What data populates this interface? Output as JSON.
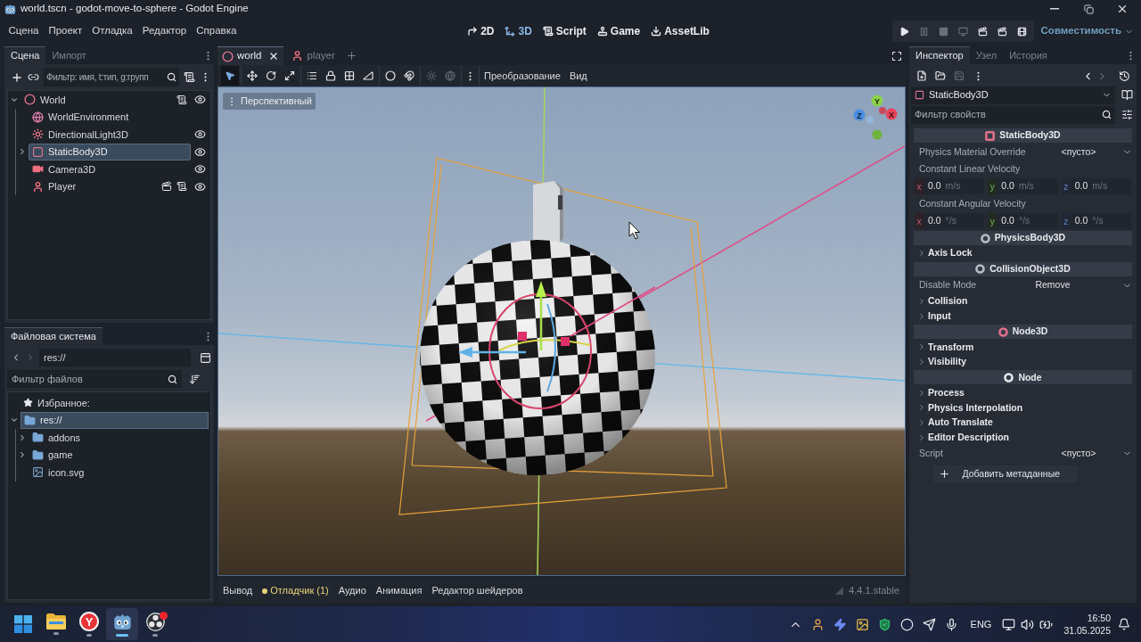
{
  "window": {
    "title": "world.tscn - godot-move-to-sphere - Godot Engine"
  },
  "menu": [
    "Сцена",
    "Проект",
    "Отладка",
    "Редактор",
    "Справка"
  ],
  "workspaces": [
    {
      "label": "2D",
      "kind": "canvas",
      "selected": false
    },
    {
      "label": "3D",
      "kind": "spatial",
      "selected": true
    },
    {
      "label": "Script",
      "kind": "script",
      "selected": false
    },
    {
      "label": "Game",
      "kind": "game",
      "selected": false
    },
    {
      "label": "AssetLib",
      "kind": "assetlib",
      "selected": false
    }
  ],
  "run_controls": [
    {
      "kind": "play",
      "disabled": false
    },
    {
      "kind": "pause",
      "disabled": true
    },
    {
      "kind": "stop",
      "disabled": true
    },
    {
      "kind": "remote",
      "disabled": true
    },
    {
      "kind": "scene",
      "disabled": false
    },
    {
      "kind": "custom",
      "disabled": false
    },
    {
      "kind": "movie",
      "disabled": false
    }
  ],
  "renderer": "Совместимость",
  "scene_dock": {
    "tabs": [
      {
        "label": "Сцена",
        "selected": true
      },
      {
        "label": "Импорт",
        "selected": false
      }
    ],
    "filter": {
      "placeholder": "Фильтр: имя, t:тип, g:групп"
    },
    "tree": [
      {
        "name": "World",
        "kind": "node3d",
        "expandable": true,
        "expanded": true,
        "selected": false,
        "instance": false,
        "script": true,
        "eye": true,
        "children": [
          {
            "name": "WorldEnvironment",
            "kind": "environment",
            "expandable": false,
            "expanded": false,
            "selected": false,
            "instance": false,
            "script": false,
            "eye": false
          },
          {
            "name": "DirectionalLight3D",
            "kind": "light",
            "expandable": false,
            "expanded": false,
            "selected": false,
            "instance": false,
            "script": false,
            "eye": true
          },
          {
            "name": "StaticBody3D",
            "kind": "body",
            "expandable": true,
            "expanded": false,
            "selected": true,
            "instance": false,
            "script": false,
            "eye": true
          },
          {
            "name": "Camera3D",
            "kind": "camera",
            "expandable": false,
            "expanded": false,
            "selected": false,
            "instance": false,
            "script": false,
            "eye": true
          },
          {
            "name": "Player",
            "kind": "character",
            "expandable": false,
            "expanded": false,
            "selected": false,
            "instance": true,
            "script": true,
            "eye": true
          }
        ]
      }
    ]
  },
  "filesystem": {
    "tabs": [
      {
        "label": "Файловая система",
        "selected": true
      }
    ],
    "path": "res://",
    "filter": {
      "placeholder": "Фильтр файлов"
    },
    "favorites": "Избранное:",
    "tree": [
      {
        "name": "res://",
        "kind": "folder",
        "expandable": true,
        "expanded": true,
        "selected": true,
        "children": [
          {
            "name": "addons",
            "kind": "folder",
            "expandable": true,
            "expanded": false,
            "selected": false
          },
          {
            "name": "game",
            "kind": "folder",
            "expandable": true,
            "expanded": false,
            "selected": false
          },
          {
            "name": "icon.svg",
            "kind": "image",
            "expandable": false,
            "expanded": false,
            "selected": false
          }
        ]
      }
    ]
  },
  "editor_tabs": [
    {
      "label": "world",
      "kind": "node3d",
      "selected": true
    },
    {
      "label": "player",
      "kind": "character",
      "selected": false
    }
  ],
  "viewport_toolbar": {
    "tool_groups": [
      [
        {
          "kind": "select",
          "selected": true,
          "disabled": false
        }
      ],
      [
        {
          "kind": "move",
          "selected": false,
          "disabled": false
        },
        {
          "kind": "rotate",
          "selected": false,
          "disabled": false
        },
        {
          "kind": "scale",
          "selected": false,
          "disabled": false
        }
      ],
      [
        {
          "kind": "list",
          "selected": false,
          "disabled": false
        },
        {
          "kind": "lock",
          "selected": false,
          "disabled": false
        },
        {
          "kind": "group",
          "selected": false,
          "disabled": false
        },
        {
          "kind": "ruler",
          "selected": false,
          "disabled": false
        }
      ],
      [
        {
          "kind": "preview",
          "selected": false,
          "disabled": false
        },
        {
          "kind": "snap",
          "selected": false,
          "disabled": false
        }
      ],
      [
        {
          "kind": "sun",
          "selected": false,
          "disabled": true
        },
        {
          "kind": "globe",
          "selected": false,
          "disabled": true
        }
      ]
    ],
    "menus": [
      "Преобразование",
      "Вид"
    ]
  },
  "viewport": {
    "view_menu": "Перспективный",
    "gizmo_axes": [
      "Y",
      "Z",
      "X"
    ]
  },
  "bottom_panel": {
    "tabs": [
      {
        "label": "Вывод",
        "alert": false
      },
      {
        "label": "Отладчик (1)",
        "alert": true
      },
      {
        "label": "Аудио",
        "alert": false
      },
      {
        "label": "Анимация",
        "alert": false
      },
      {
        "label": "Редактор шейдеров",
        "alert": false
      }
    ],
    "version": "4.4.1.stable"
  },
  "inspector": {
    "tabs": [
      {
        "label": "Инспектор",
        "selected": true
      },
      {
        "label": "Узел",
        "selected": false
      },
      {
        "label": "История",
        "selected": false
      }
    ],
    "toolbar": [
      {
        "kind": "new",
        "disabled": false
      },
      {
        "kind": "open",
        "disabled": false
      },
      {
        "kind": "save",
        "disabled": true
      }
    ],
    "history_nav": [
      {
        "kind": "back",
        "disabled": false
      },
      {
        "kind": "forward",
        "disabled": true
      }
    ],
    "object": "StaticBody3D",
    "filter": {
      "placeholder": "Фильтр свойств"
    },
    "items": [
      {
        "kind": "body",
        "label": "StaticBody3D",
        "color": "#e0708a"
      },
      {
        "kind": "resource",
        "label": "Physics Material Override",
        "value": "<пусто>"
      },
      {
        "kind": "vector3",
        "label": "Constant Linear Velocity",
        "components": [
          {
            "axis": "x",
            "value": "0.0",
            "unit": "m/s"
          },
          {
            "axis": "y",
            "value": "0.0",
            "unit": "m/s"
          },
          {
            "axis": "z",
            "value": "0.0",
            "unit": "m/s"
          }
        ]
      },
      {
        "kind": "vector3",
        "label": "Constant Angular Velocity",
        "components": [
          {
            "axis": "x",
            "value": "0.0",
            "unit": "°/s"
          },
          {
            "axis": "y",
            "value": "0.0",
            "unit": "°/s"
          },
          {
            "axis": "z",
            "value": "0.0",
            "unit": "°/s"
          }
        ]
      },
      {
        "kind": "class",
        "label": "PhysicsBody3D",
        "color": "#b8bcc4"
      },
      {
        "kind": "group",
        "label": "Axis Lock"
      },
      {
        "kind": "class",
        "label": "CollisionObject3D",
        "color": "#b8bcc4"
      },
      {
        "kind": "enum",
        "label": "Disable Mode",
        "value": "Remove"
      },
      {
        "kind": "group",
        "label": "Collision"
      },
      {
        "kind": "group",
        "label": "Input"
      },
      {
        "kind": "class",
        "label": "Node3D",
        "color": "#e0708a"
      },
      {
        "kind": "group",
        "label": "Transform"
      },
      {
        "kind": "group",
        "label": "Visibility"
      },
      {
        "kind": "class",
        "label": "Node",
        "color": "#e6e8ec"
      },
      {
        "kind": "group",
        "label": "Process"
      },
      {
        "kind": "group",
        "label": "Physics Interpolation"
      },
      {
        "kind": "group",
        "label": "Auto Translate"
      },
      {
        "kind": "group",
        "label": "Editor Description"
      },
      {
        "kind": "resource",
        "label": "Script",
        "value": "<пусто>"
      },
      {
        "kind": "button",
        "label": "Добавить метаданные"
      }
    ]
  },
  "taskbar": {
    "apps": [
      {
        "kind": "start",
        "running": false,
        "selected": false,
        "badge": false
      },
      {
        "kind": "folder",
        "running": true,
        "selected": false,
        "badge": false
      },
      {
        "kind": "browser",
        "glyph": "Y",
        "running": true,
        "selected": false,
        "badge": false
      },
      {
        "kind": "robot",
        "running": true,
        "selected": true,
        "badge": false
      },
      {
        "kind": "recorder",
        "running": true,
        "selected": false,
        "badge": true
      }
    ],
    "language": "ENG",
    "time": "16:50",
    "date": "31.05.2025"
  }
}
